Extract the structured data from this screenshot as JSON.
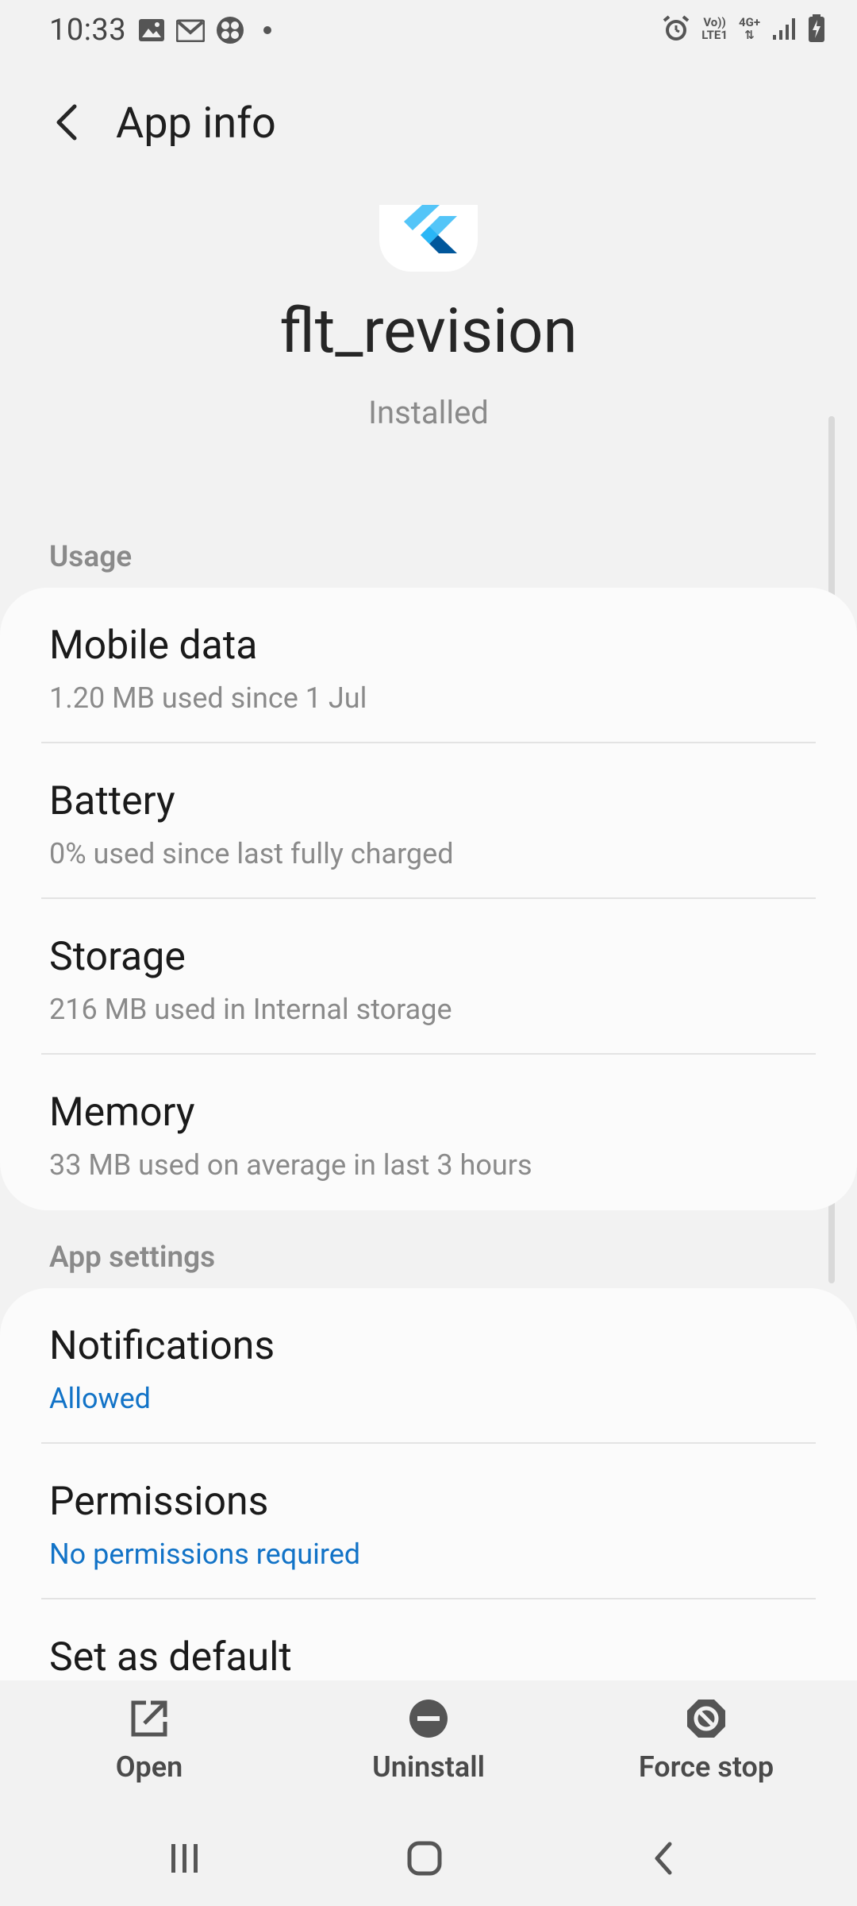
{
  "status_bar": {
    "time": "10:33",
    "left_icons": [
      "image-icon",
      "gmail-icon",
      "pinwheel-icon",
      "dot-icon"
    ],
    "right_icons": [
      "alarm-icon",
      "volte-icon",
      "4g-icon",
      "signal-icon",
      "battery-charging-icon"
    ],
    "volte_label_top": "Vo))",
    "volte_label_bottom": "LTE1",
    "network_label": "4G+"
  },
  "header": {
    "title": "App info",
    "back_icon": "chevron-left-icon"
  },
  "app": {
    "name": "flt_revision",
    "status": "Installed",
    "icon": "flutter-logo"
  },
  "sections": {
    "usage": {
      "header": "Usage",
      "items": [
        {
          "title": "Mobile data",
          "subtitle": "1.20 MB used since 1 Jul"
        },
        {
          "title": "Battery",
          "subtitle": "0% used since last fully charged"
        },
        {
          "title": "Storage",
          "subtitle": "216 MB used in Internal storage"
        },
        {
          "title": "Memory",
          "subtitle": "33 MB used on average in last 3 hours"
        }
      ]
    },
    "app_settings": {
      "header": "App settings",
      "items": [
        {
          "title": "Notifications",
          "subtitle": "Allowed"
        },
        {
          "title": "Permissions",
          "subtitle": "No permissions required"
        },
        {
          "title": "Set as default",
          "subtitle": ""
        }
      ]
    }
  },
  "actions": {
    "open": "Open",
    "uninstall": "Uninstall",
    "force_stop": "Force stop"
  },
  "colors": {
    "background": "#f2f2f2",
    "card": "#fbfbfb",
    "accent_blue": "#1273c7",
    "secondary_text": "#8a8a8a"
  },
  "navbar": {
    "icons": [
      "recents-icon",
      "home-icon",
      "back-icon"
    ]
  }
}
